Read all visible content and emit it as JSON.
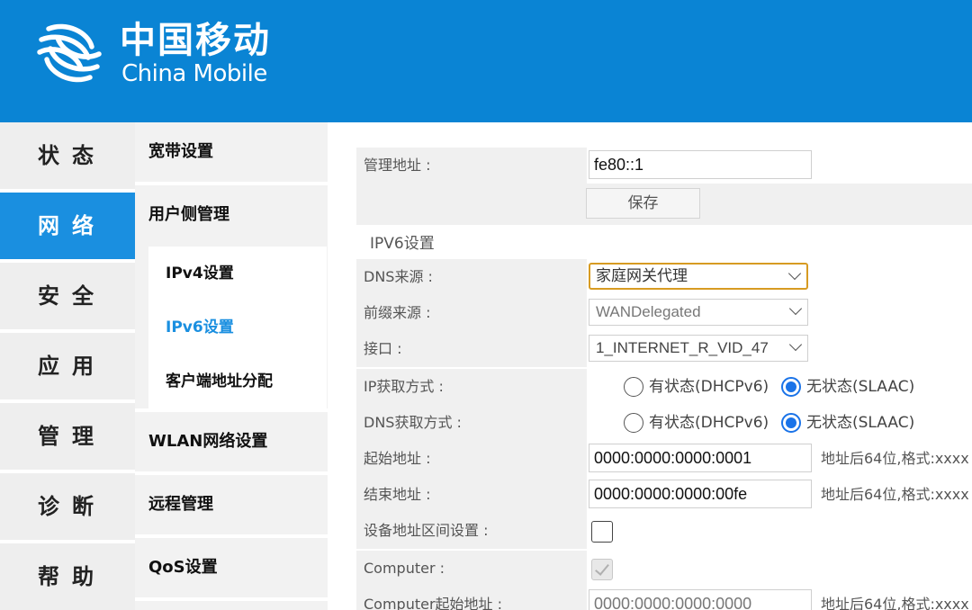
{
  "brand": {
    "name_cn": "中国移动",
    "name_en": "China Mobile"
  },
  "main_nav": [
    {
      "label": "状态",
      "active": false
    },
    {
      "label": "网络",
      "active": true
    },
    {
      "label": "安全",
      "active": false
    },
    {
      "label": "应用",
      "active": false
    },
    {
      "label": "管理",
      "active": false
    },
    {
      "label": "诊断",
      "active": false
    },
    {
      "label": "帮助",
      "active": false
    }
  ],
  "sub_nav": {
    "broadband": "宽带设置",
    "user_side": "用户侧管理",
    "ipv4": "IPv4设置",
    "ipv6": "IPv6设置",
    "dhcp_alloc": "客户端地址分配",
    "wlan": "WLAN网络设置",
    "remote": "远程管理",
    "qos": "QoS设置"
  },
  "form": {
    "mgmt_address": {
      "label": "管理地址 :",
      "value": "fe80::1"
    },
    "save_label": "保存",
    "section_title": "IPV6设置",
    "dns_source": {
      "label": "DNS来源 :",
      "value": "家庭网关代理"
    },
    "prefix_source": {
      "label": "前缀来源 :",
      "value": "WANDelegated"
    },
    "interface": {
      "label": "接口 :",
      "value": "1_INTERNET_R_VID_47"
    },
    "ip_method": {
      "label": "IP获取方式 :",
      "option1": "有状态(DHCPv6)",
      "option2": "无状态(SLAAC)",
      "selected": "option2"
    },
    "dns_method": {
      "label": "DNS获取方式 :",
      "option1": "有状态(DHCPv6)",
      "option2": "无状态(SLAAC)",
      "selected": "option2"
    },
    "start_address": {
      "label": "起始地址 :",
      "value": "0000:0000:0000:0001",
      "hint": "地址后64位,格式:xxxx"
    },
    "end_address": {
      "label": "结束地址 :",
      "value": "0000:0000:0000:00fe",
      "hint": "地址后64位,格式:xxxx"
    },
    "device_range": {
      "label": "设备地址区间设置 :",
      "checked": false
    },
    "computer": {
      "label": "Computer :",
      "checked": true
    },
    "computer_start": {
      "label": "Computer起始地址 :",
      "value": "0000:0000:0000:0000",
      "hint": "地址后64位,格式:xxxx"
    }
  }
}
